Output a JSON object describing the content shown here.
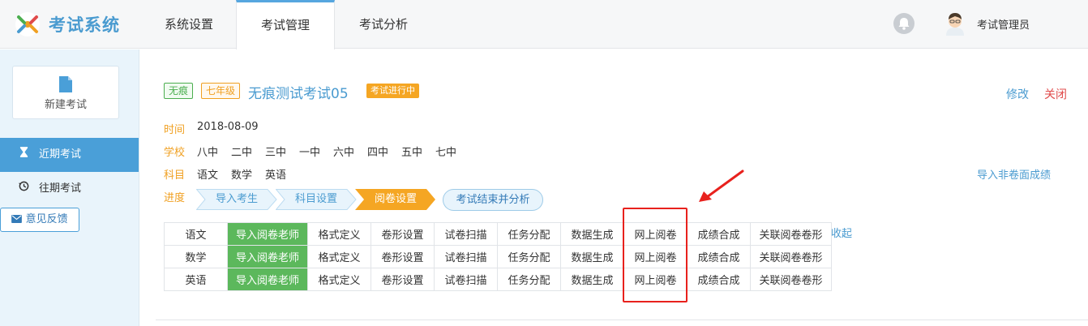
{
  "header": {
    "app_name": "考试系统",
    "nav": [
      "系统设置",
      "考试管理",
      "考试分析"
    ],
    "active_nav": 1,
    "user_name": "考试管理员"
  },
  "sidebar": {
    "new_exam_label": "新建考试",
    "items": [
      {
        "label": "近期考试",
        "icon": "hourglass-icon",
        "active": true
      },
      {
        "label": "往期考试",
        "icon": "history-icon",
        "active": false
      }
    ],
    "feedback_label": "意见反馈"
  },
  "exam": {
    "tag_type": "无痕",
    "tag_grade": "七年级",
    "title": "无痕测试考试05",
    "status": "考试进行中",
    "edit_label": "修改",
    "close_label": "关闭",
    "time_label": "时间",
    "time_value": "2018-08-09",
    "school_label": "学校",
    "schools": [
      "八中",
      "二中",
      "三中",
      "一中",
      "六中",
      "四中",
      "五中",
      "七中"
    ],
    "subject_label": "科目",
    "subjects": [
      "语文",
      "数学",
      "英语"
    ],
    "progress_label": "进度",
    "import_nonpaper_label": "导入非卷面成绩"
  },
  "steps": {
    "items": [
      "导入考生",
      "科目设置",
      "阅卷设置"
    ],
    "active": 2,
    "end_label": "考试结束并分析"
  },
  "table": {
    "actions": [
      "导入阅卷老师",
      "格式定义",
      "卷形设置",
      "试卷扫描",
      "任务分配",
      "数据生成",
      "网上阅卷",
      "成绩合成",
      "关联阅卷卷形"
    ],
    "rows": [
      "语文",
      "数学",
      "英语"
    ],
    "collapse_label": "收起"
  },
  "colors": {
    "accent": "#4a9fd8",
    "green": "#5cb85c",
    "orange": "#f0a022",
    "highlight": "#e8211d"
  }
}
